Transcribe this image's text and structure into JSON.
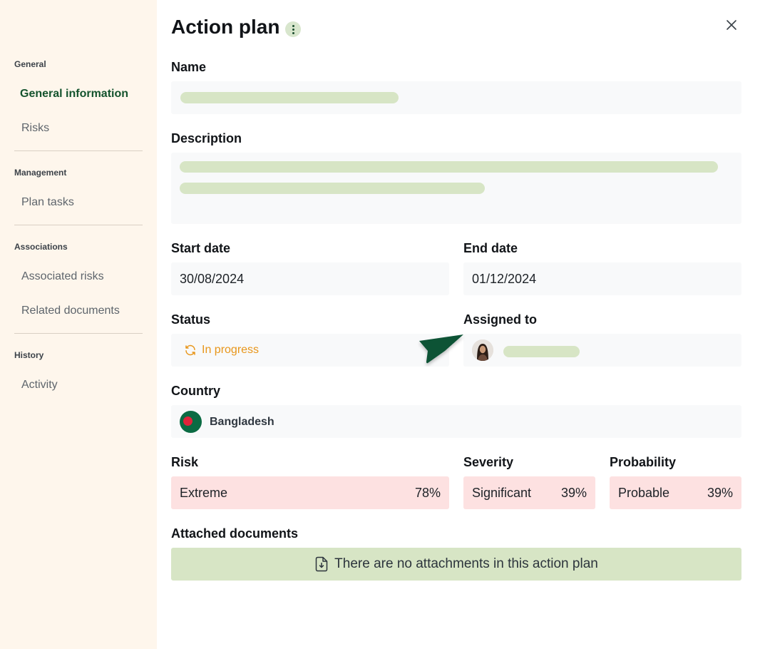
{
  "sidebar": {
    "sections": [
      {
        "title": "General",
        "items": [
          {
            "label": "General information",
            "active": true
          },
          {
            "label": "Risks"
          }
        ]
      },
      {
        "title": "Management",
        "items": [
          {
            "label": "Plan tasks"
          }
        ]
      },
      {
        "title": "Associations",
        "items": [
          {
            "label": "Associated risks"
          },
          {
            "label": "Related documents"
          }
        ]
      },
      {
        "title": "History",
        "items": [
          {
            "label": "Activity"
          }
        ]
      }
    ]
  },
  "panel": {
    "title": "Action plan",
    "menu_icon": "more-vertical-icon",
    "close_icon": "close-icon"
  },
  "form": {
    "name_label": "Name",
    "description_label": "Description",
    "start_date_label": "Start date",
    "start_date_value": "30/08/2024",
    "end_date_label": "End date",
    "end_date_value": "01/12/2024",
    "status_label": "Status",
    "status_value": "In progress",
    "status_color": "#e8961a",
    "assigned_label": "Assigned to",
    "country_label": "Country",
    "country_value": "Bangladesh",
    "risk_label": "Risk",
    "risk_value": "Extreme",
    "risk_pct": "78%",
    "severity_label": "Severity",
    "severity_value": "Significant",
    "severity_pct": "39%",
    "probability_label": "Probability",
    "probability_value": "Probable",
    "probability_pct": "39%",
    "attachments_label": "Attached documents",
    "attachments_empty": "There are no attachments in this action plan"
  },
  "colors": {
    "sidebar_bg": "#fef6ec",
    "accent": "#14532d",
    "skeleton": "#d7e5c5",
    "risk_bg": "#fde1e1",
    "field_bg": "#f8f9fa"
  }
}
